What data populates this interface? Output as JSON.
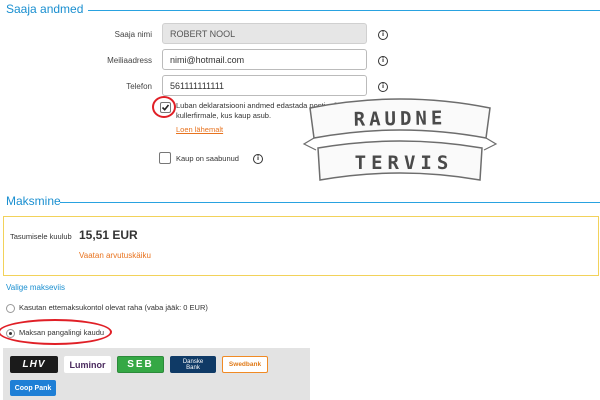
{
  "recipient_section": {
    "title": "Saaja andmed",
    "name_label": "Saaja nimi",
    "name_value": "ROBERT NOOL",
    "email_label": "Meiliaadress",
    "email_value": "nimi@hotmail.com",
    "phone_label": "Telefon",
    "phone_value": "561111111111",
    "consent_text": "Luban deklaratsiooni andmed edastada posti- või kullerfirmale, kus kaup asub.",
    "read_more_link": "Loen lähemalt",
    "arrived_label": "Kaup on saabunud"
  },
  "payment_section": {
    "title": "Maksmine",
    "total_label": "Tasumisele kuulub",
    "total_value": "15,51 EUR",
    "calc_link": "Vaatan arvutuskäiku",
    "method_title": "Valige makseviis",
    "option_prepaid": "Kasutan ettemaksukontol olevat raha (vaba jääk: 0 EUR)",
    "option_bank": "Maksan pangalingi kaudu"
  },
  "banks": [
    {
      "name": "LHV",
      "color": "#1b1b1b"
    },
    {
      "name": "Luminor",
      "color": "#4a2a5e"
    },
    {
      "name": "SEB",
      "color": "#35a845"
    },
    {
      "name": "Danske Bank",
      "color": "#0f3a66"
    },
    {
      "name": "Swedbank",
      "color": "#f08a24"
    },
    {
      "name": "Coop Pank",
      "color": "#1e7fd6"
    }
  ],
  "watermark": {
    "line1": "RAUDNE",
    "line2": "TERVIS"
  },
  "colors": {
    "accent": "#29a2e0",
    "annotation": "#e01f26",
    "link": "#e8731f",
    "highlight_border": "#f2d25a"
  }
}
